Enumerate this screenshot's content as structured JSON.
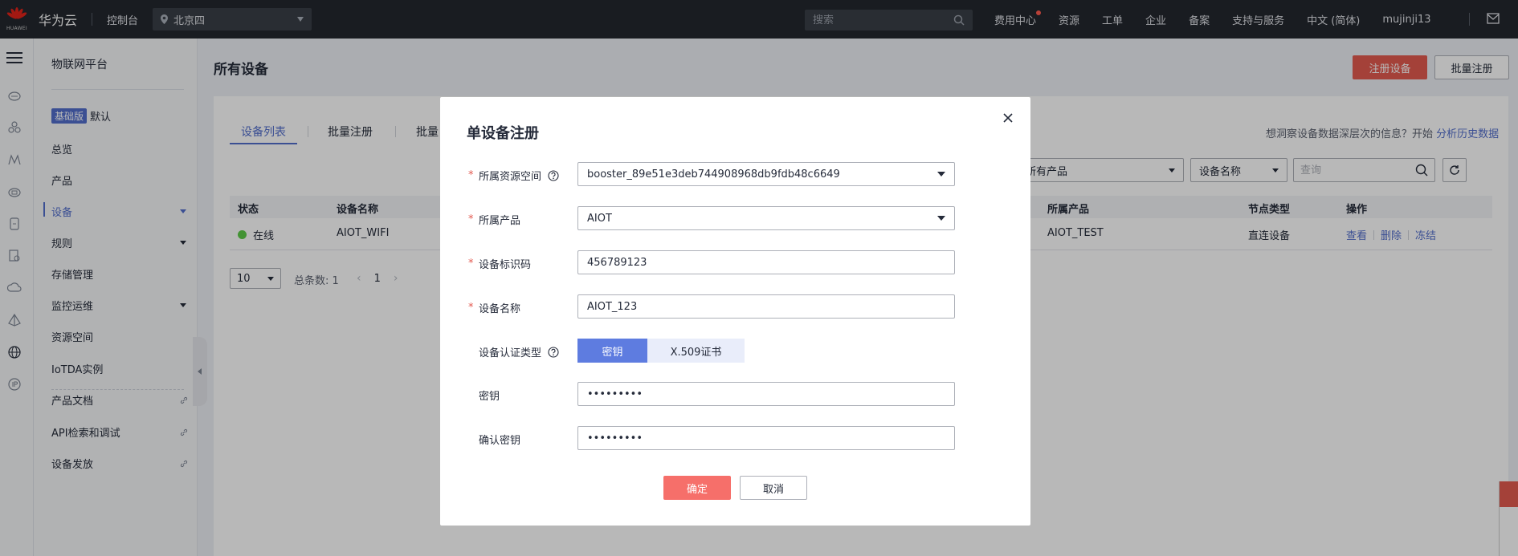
{
  "topbar": {
    "logo_sub": "HUAWEI",
    "brand": "华为云",
    "console": "控制台",
    "region": "北京四",
    "search_placeholder": "搜索",
    "nav": [
      "费用中心",
      "资源",
      "工单",
      "企业",
      "备案",
      "支持与服务",
      "中文 (简体)",
      "mujinji13"
    ]
  },
  "sidebar": {
    "title": "物联网平台",
    "badge": "基础版",
    "badge_suffix": "默认",
    "items": [
      "总览",
      "产品",
      "设备",
      "规则",
      "存储管理",
      "监控运维",
      "资源空间",
      "IoTDA实例",
      "产品文档",
      "API检索和调试",
      "设备发放"
    ]
  },
  "main": {
    "title": "所有设备",
    "register_button": "注册设备",
    "batch_button": "批量注册",
    "tabs": [
      "设备列表",
      "批量注册",
      "批量"
    ],
    "hint_text": "想洞察设备数据深层次的信息？开始",
    "hint_link": "分析历史数据",
    "filter_product": "所有产品",
    "filter_field": "设备名称",
    "search_placeholder": "查询",
    "columns": [
      "状态",
      "设备名称",
      "所属产品",
      "节点类型",
      "操作"
    ],
    "rows": [
      {
        "status": "在线",
        "name": "AIOT_WIFI",
        "product": "AIOT_TEST",
        "node_type": "直连设备",
        "ops": [
          "查看",
          "删除",
          "冻结"
        ]
      }
    ],
    "page_size": "10",
    "total": "总条数: 1",
    "page": "1"
  },
  "modal": {
    "title": "单设备注册",
    "fields": {
      "space_label": "所属资源空间",
      "space_value": "booster_89e51e3deb744908968db9fdb48c6649",
      "product_label": "所属产品",
      "product_value": "AIOT",
      "identifier_label": "设备标识码",
      "identifier_value": "456789123",
      "name_label": "设备名称",
      "name_value": "AIOT_123",
      "auth_label": "设备认证类型",
      "auth_options": [
        "密钥",
        "X.509证书"
      ],
      "secret_label": "密钥",
      "secret_value": "•••••••••",
      "confirm_label": "确认密钥",
      "confirm_value": "•••••••••"
    },
    "ok_button": "确定",
    "cancel_button": "取消"
  }
}
